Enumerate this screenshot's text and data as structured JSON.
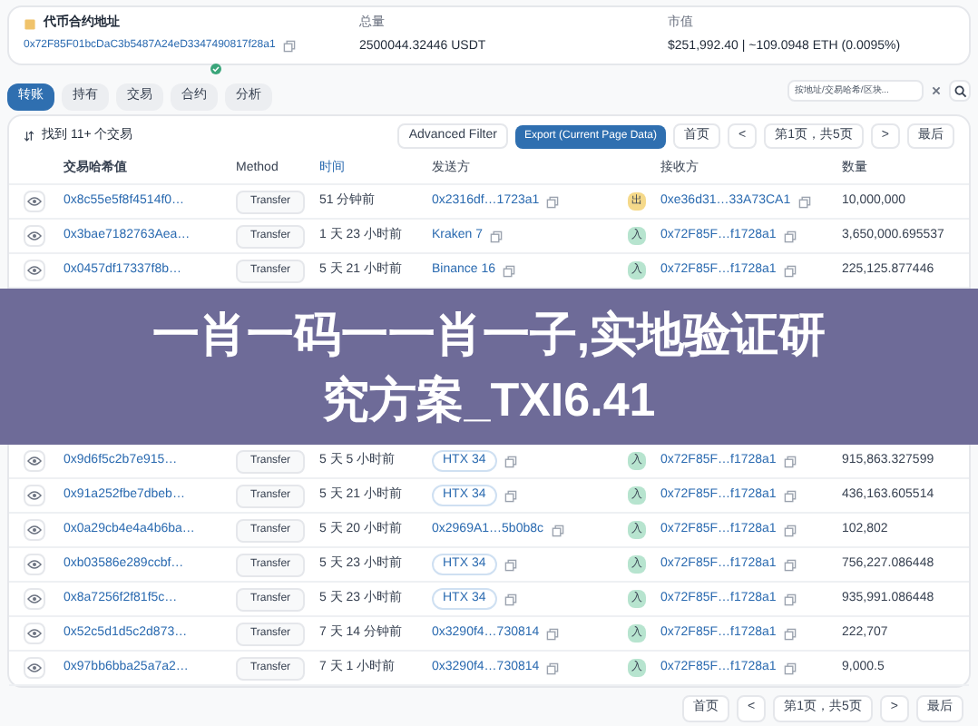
{
  "token_card": {
    "contract_label": "代币合约地址",
    "contract_address": "0x72F85F01bcDaC3b5487A24eD3347490817f28a1",
    "supply_label": "总量",
    "supply_value": "2500044.32446 USDT",
    "market_label": "市值",
    "market_value": "$251,992.40 | ~109.0948 ETH (0.0095%)"
  },
  "tabs": [
    {
      "label": "转账",
      "selected": true,
      "verified": false
    },
    {
      "label": "持有",
      "selected": false,
      "verified": false
    },
    {
      "label": "交易",
      "selected": false,
      "verified": false
    },
    {
      "label": "合约",
      "selected": false,
      "verified": true
    },
    {
      "label": "分析",
      "selected": false,
      "verified": false
    }
  ],
  "search": {
    "placeholder": "按地址/交易哈希/区块..."
  },
  "list_header": {
    "summary": "找到 11+ 个交易",
    "filter_button": "Advanced Filter",
    "export_button": "Export (Current Page Data)"
  },
  "pagination_top": {
    "first": "首页",
    "prev": "<",
    "page": "第1页，共5页",
    "next": ">",
    "last": "最后"
  },
  "table": {
    "columns": [
      "交易哈希值",
      "Method",
      "时间",
      "发送方",
      "接收方",
      "数量"
    ],
    "rows": [
      {
        "hash": "0x8c55e5f8f4514f0…",
        "method": "Transfer",
        "age": "51 分钟前",
        "from": "0x2316df…1723a1",
        "kind": "address",
        "direction": "出",
        "color": "#f5d98a",
        "to": "0xe36d31…33A73CA1",
        "amount": "10,000,000"
      },
      {
        "hash": "0x3bae7182763Aea…",
        "method": "Transfer",
        "age": "1 天 23 小时前",
        "from": "Kraken 7",
        "kind": "address",
        "direction": "入",
        "color": "#b7e4cf",
        "to": "0x72F85F…f1728a1",
        "amount": "3,650,000.695537"
      },
      {
        "hash": "0x0457df17337f8b…",
        "method": "Transfer",
        "age": "5 天 21 小时前",
        "from": "Binance 16",
        "kind": "address",
        "direction": "入",
        "color": "#b7e4cf",
        "to": "0x72F85F…f1728a1",
        "amount": "225,125.877446"
      }
    ]
  },
  "banner": {
    "lines": [
      "一肖一码一一肖一子,实地验证研",
      "究方案_TXI6.41"
    ]
  },
  "table_lower": {
    "rows": [
      {
        "hash": "0x9d6f5c2b7e915…",
        "method": "Transfer",
        "age": "5 天 5 小时前",
        "from": "HTX 34",
        "kind": "tag",
        "direction": "入",
        "color": "#b7e4cf",
        "to": "0x72F85F…f1728a1",
        "amount": "915,863.327599"
      },
      {
        "hash": "0x91a252fbe7dbeb…",
        "method": "Transfer",
        "age": "5 天 21 小时前",
        "from": "HTX 34",
        "kind": "tag",
        "direction": "入",
        "color": "#b7e4cf",
        "to": "0x72F85F…f1728a1",
        "amount": "436,163.605514"
      },
      {
        "hash": "0x0a29cb4e4a4b6ba…",
        "method": "Transfer",
        "age": "5 天 20 小时前",
        "from": "0x2969A1…5b0b8c",
        "kind": "address",
        "direction": "入",
        "color": "#b7e4cf",
        "to": "0x72F85F…f1728a1",
        "amount": "102,802"
      },
      {
        "hash": "0xb03586e289ccbf…",
        "method": "Transfer",
        "age": "5 天 23 小时前",
        "from": "HTX 34",
        "kind": "tag",
        "direction": "入",
        "color": "#b7e4cf",
        "to": "0x72F85F…f1728a1",
        "amount": "756,227.086448"
      },
      {
        "hash": "0x8a7256f2f81f5c…",
        "method": "Transfer",
        "age": "5 天 23 小时前",
        "from": "HTX 34",
        "kind": "tag",
        "direction": "入",
        "color": "#b7e4cf",
        "to": "0x72F85F…f1728a1",
        "amount": "935,991.086448"
      },
      {
        "hash": "0x52c5d1d5c2d873…",
        "method": "Transfer",
        "age": "7 天 14 分钟前",
        "from": "0x3290f4…730814",
        "kind": "address",
        "direction": "入",
        "color": "#b7e4cf",
        "to": "0x72F85F…f1728a1",
        "amount": "222,707"
      },
      {
        "hash": "0x97bb6bba25a7a2…",
        "method": "Transfer",
        "age": "7 天 1 小时前",
        "from": "0x3290f4…730814",
        "kind": "address",
        "direction": "入",
        "color": "#b7e4cf",
        "to": "0x72F85F…f1728a1",
        "amount": "9,000.5"
      }
    ]
  },
  "pagination_bottom": {
    "first": "首页",
    "prev": "<",
    "page": "第1页，共5页",
    "next": ">",
    "last": "最后"
  }
}
